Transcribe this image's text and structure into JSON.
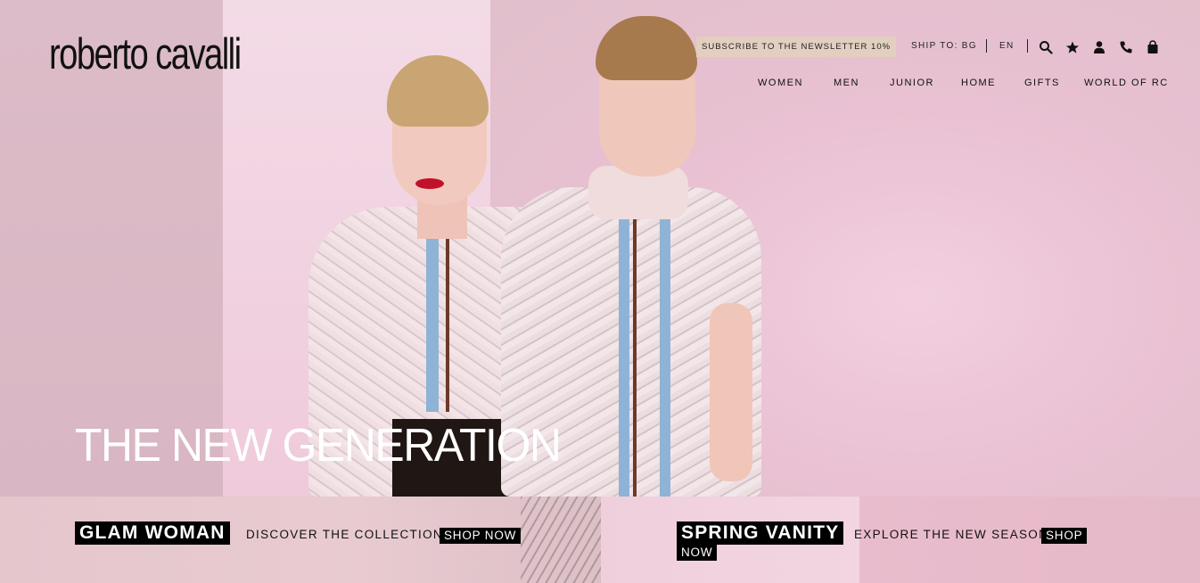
{
  "brand": {
    "logo_text": "roberto cavalli"
  },
  "header": {
    "newsletter_label": "SUBSCRIBE TO THE NEWSLETTER 10%",
    "ship_to_label": "SHIP TO: BG",
    "language": "EN",
    "icons": [
      "search-icon",
      "wishlist-star-icon",
      "account-icon",
      "phone-icon",
      "shopping-bag-icon"
    ]
  },
  "nav": {
    "items": [
      {
        "label": "WOMEN"
      },
      {
        "label": "MEN"
      },
      {
        "label": "JUNIOR"
      },
      {
        "label": "HOME"
      },
      {
        "label": "GIFTS"
      },
      {
        "label": "WORLD OF RC"
      }
    ]
  },
  "hero": {
    "title": "THE NEW GENERATION"
  },
  "promos": [
    {
      "title": "GLAM WOMAN",
      "subtitle": "DISCOVER THE COLLECTION",
      "cta": "SHOP NOW"
    },
    {
      "title": "SPRING VANITY",
      "subtitle": "EXPLORE THE NEW SEASON",
      "cta_line1": "SHOP",
      "cta_line2": "NOW"
    }
  ],
  "colors": {
    "accent": "#000000",
    "newsletter_bg": "#e2cfc0",
    "hero_bg": "#e6c3cf"
  }
}
